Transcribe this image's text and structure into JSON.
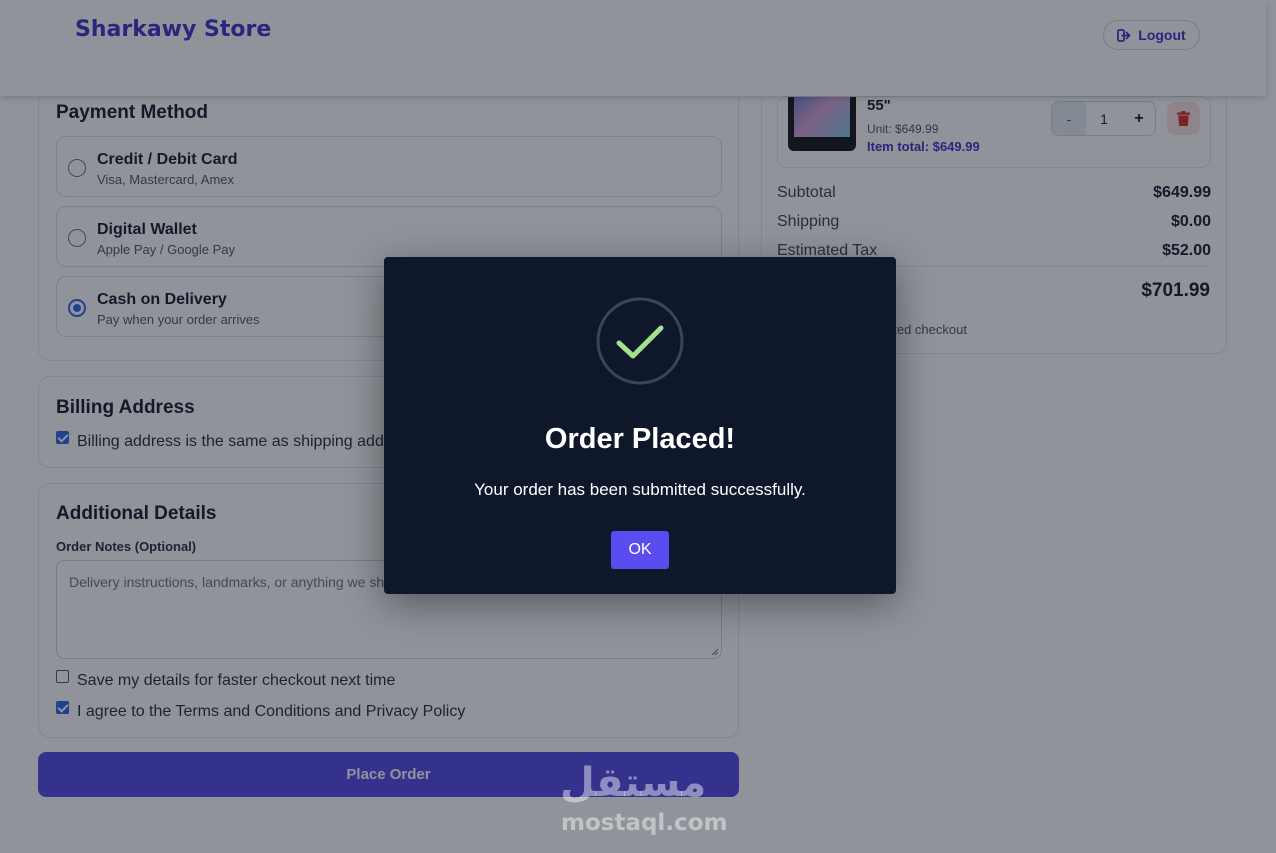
{
  "header": {
    "brand": "Sharkawy Store",
    "logout_label": "Logout"
  },
  "payment": {
    "title": "Payment Method",
    "selected": "cash",
    "options": [
      {
        "key": "card",
        "title": "Credit / Debit Card",
        "subtitle": "Visa, Mastercard, Amex"
      },
      {
        "key": "wallet",
        "title": "Digital Wallet",
        "subtitle": "Apple Pay / Google Pay"
      },
      {
        "key": "cash",
        "title": "Cash on Delivery",
        "subtitle": "Pay when your order arrives"
      }
    ]
  },
  "billing": {
    "title": "Billing Address",
    "same_as_shipping_label": "Billing address is the same as shipping addr",
    "same_as_shipping_checked": true
  },
  "additional": {
    "title": "Additional Details",
    "notes_label": "Order Notes (Optional)",
    "notes_placeholder": "Delivery instructions, landmarks, or anything we sho",
    "save_details_label": "Save my details for faster checkout next time",
    "save_details_checked": false,
    "agree_label": "I agree to the Terms and Conditions and Privacy Policy",
    "agree_checked": true
  },
  "place_order_label": "Place Order",
  "summary": {
    "item": {
      "name": "55\"",
      "unit_price": "Unit: $649.99",
      "item_total": "Item total: $649.99",
      "quantity": "1",
      "minus": "-",
      "plus": "+"
    },
    "rows": [
      {
        "label": "Subtotal",
        "value": "$649.99"
      },
      {
        "label": "Shipping",
        "value": "$0.00"
      },
      {
        "label": "Estimated Tax",
        "value": "$52.00"
      }
    ],
    "total_value": "$701.99",
    "secure_note": "pted checkout"
  },
  "modal": {
    "title": "Order Placed!",
    "message": "Your order has been submitted successfully.",
    "ok_label": "OK",
    "check_color": "#a3e18f"
  },
  "watermark": {
    "logo_text": "مستقل",
    "domain": "mostaql.com"
  },
  "colors": {
    "brand": "#3b2fc9",
    "primary_button": "#4f46e5",
    "modal_bg": "#0f172a",
    "ok_button": "#5b4cf0",
    "danger_soft": "#fde2e2"
  }
}
